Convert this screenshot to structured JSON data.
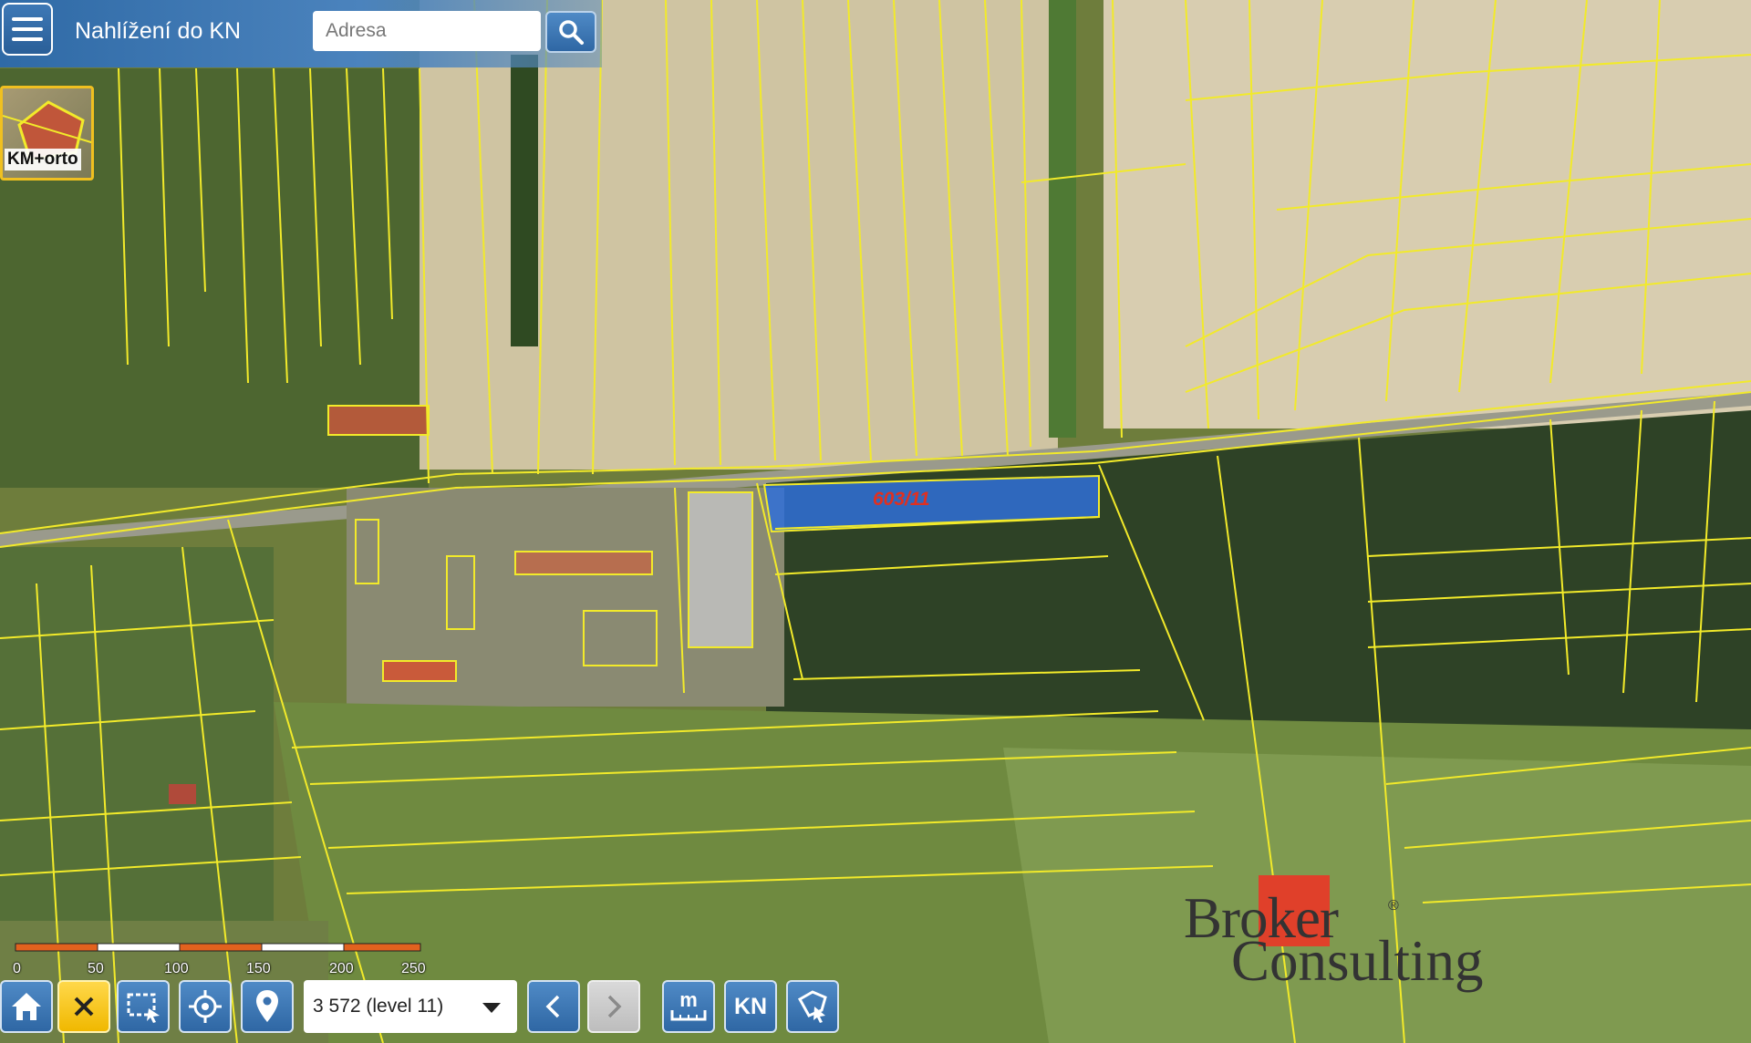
{
  "app": {
    "title": "Nahlížení do KN"
  },
  "search": {
    "placeholder": "Adresa"
  },
  "layer": {
    "label": "KM+orto"
  },
  "scale": {
    "labels": [
      "0",
      "50",
      "100",
      "150",
      "200",
      "250 m"
    ]
  },
  "zoom": {
    "value": "3 572 (level 11)"
  },
  "toolbar": {
    "kn_label": "KN",
    "measure_label": "m"
  },
  "map": {
    "parcel_label": "603/11",
    "highlight_color": "#2f6fd8",
    "parcel_line_color": "#f2ea2a"
  },
  "watermark": {
    "line1": "Broker",
    "line2": "Consulting",
    "reg": "®",
    "accent": "#e0402a"
  },
  "icons": [
    "menu-icon",
    "search-icon",
    "home-icon",
    "close-icon",
    "box-select-icon",
    "locate-icon",
    "pin-icon",
    "chevron-left-icon",
    "chevron-right-icon",
    "measure-icon",
    "polygon-icon"
  ]
}
